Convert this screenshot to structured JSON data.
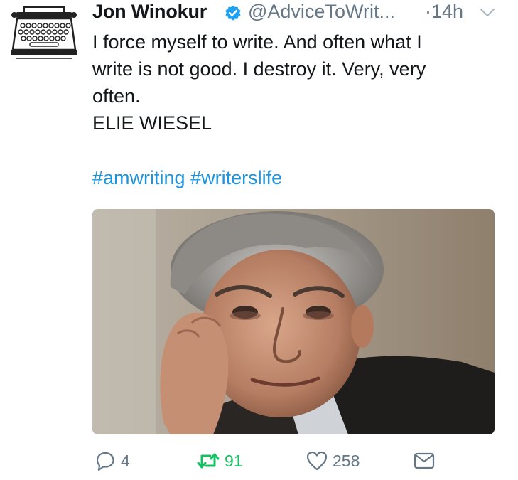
{
  "tweet": {
    "author_name": "Jon Winokur",
    "handle": "@AdviceToWrit...",
    "time_separator": "·",
    "time": "14h",
    "text_lines": [
      "I force myself to write. And often what I",
      "write is not good. I destroy it. Very, very",
      "often.",
      "ELIE WIESEL"
    ],
    "hashtags": [
      "#amwriting",
      "#writerslife"
    ]
  },
  "actions": {
    "reply_count": "4",
    "retweet_count": "91",
    "like_count": "258"
  },
  "icons": {
    "verified": "verified-badge-icon",
    "menu": "chevron-down-icon",
    "reply": "reply-bubble-icon",
    "retweet": "retweet-icon",
    "like": "heart-icon",
    "dm": "envelope-icon",
    "avatar": "typewriter-icon"
  },
  "colors": {
    "text": "#14171a",
    "secondary": "#657786",
    "link": "#1b95e0",
    "verified": "#1da1f2",
    "retweeted": "#17bf63"
  }
}
